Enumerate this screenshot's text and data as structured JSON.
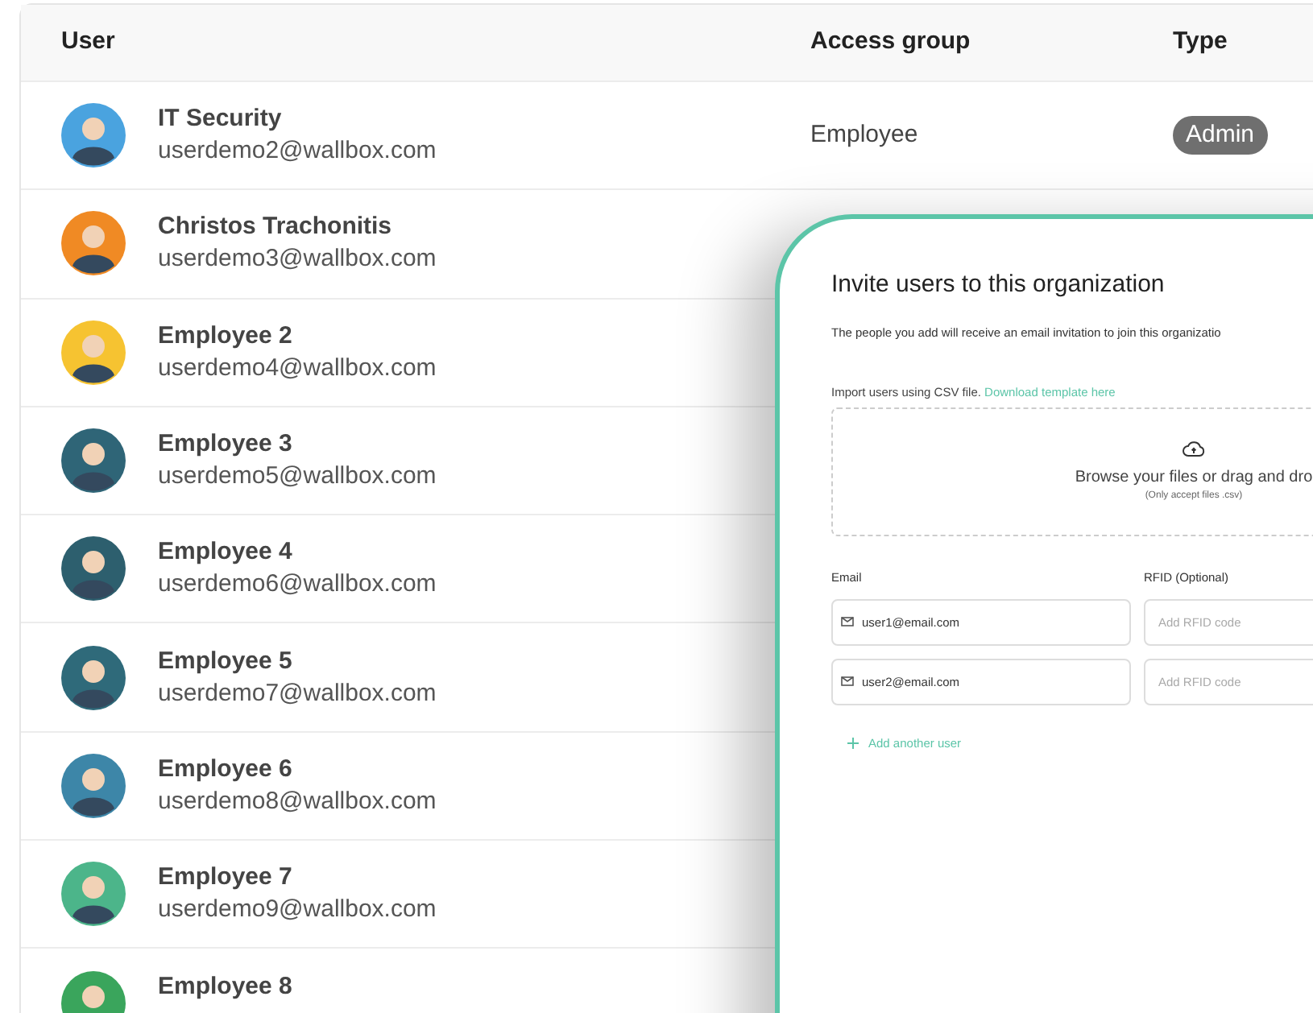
{
  "table": {
    "columns": [
      "User",
      "Access group",
      "Type"
    ],
    "rows": [
      {
        "name": "IT Security",
        "email": "userdemo2@wallbox.com",
        "access_group": "Employee",
        "type": "Admin",
        "color": "#4aa3df"
      },
      {
        "name": "Christos Trachonitis",
        "email": "userdemo3@wallbox.com",
        "color": "#f08a24"
      },
      {
        "name": "Employee 2",
        "email": "userdemo4@wallbox.com",
        "color": "#f6c331"
      },
      {
        "name": "Employee 3",
        "email": "userdemo5@wallbox.com",
        "color": "#2f6577"
      },
      {
        "name": "Employee 4",
        "email": "userdemo6@wallbox.com",
        "color": "#2d5f6e"
      },
      {
        "name": "Employee 5",
        "email": "userdemo7@wallbox.com",
        "color": "#2f6a7a"
      },
      {
        "name": "Employee 6",
        "email": "userdemo8@wallbox.com",
        "color": "#3d86a8"
      },
      {
        "name": "Employee 7",
        "email": "userdemo9@wallbox.com",
        "color": "#4cb58a"
      },
      {
        "name": "Employee 8",
        "color": "#3aa55c"
      }
    ]
  },
  "invite_dialog": {
    "title": "Invite users to this organization",
    "description": "The people you add will receive an email invitation to join this organizatio",
    "import_label": "Import users using CSV file.",
    "import_link": "Download template here",
    "dropzone": {
      "text": "Browse your files or drag and dro",
      "hint": "(Only accept files .csv)"
    },
    "email_label": "Email",
    "rfid_label": "RFID (Optional)",
    "users": [
      {
        "email": "user1@email.com",
        "rfid_placeholder": "Add RFID code"
      },
      {
        "email": "user2@email.com",
        "rfid_placeholder": "Add RFID code"
      }
    ],
    "add_button": "Add another user"
  }
}
